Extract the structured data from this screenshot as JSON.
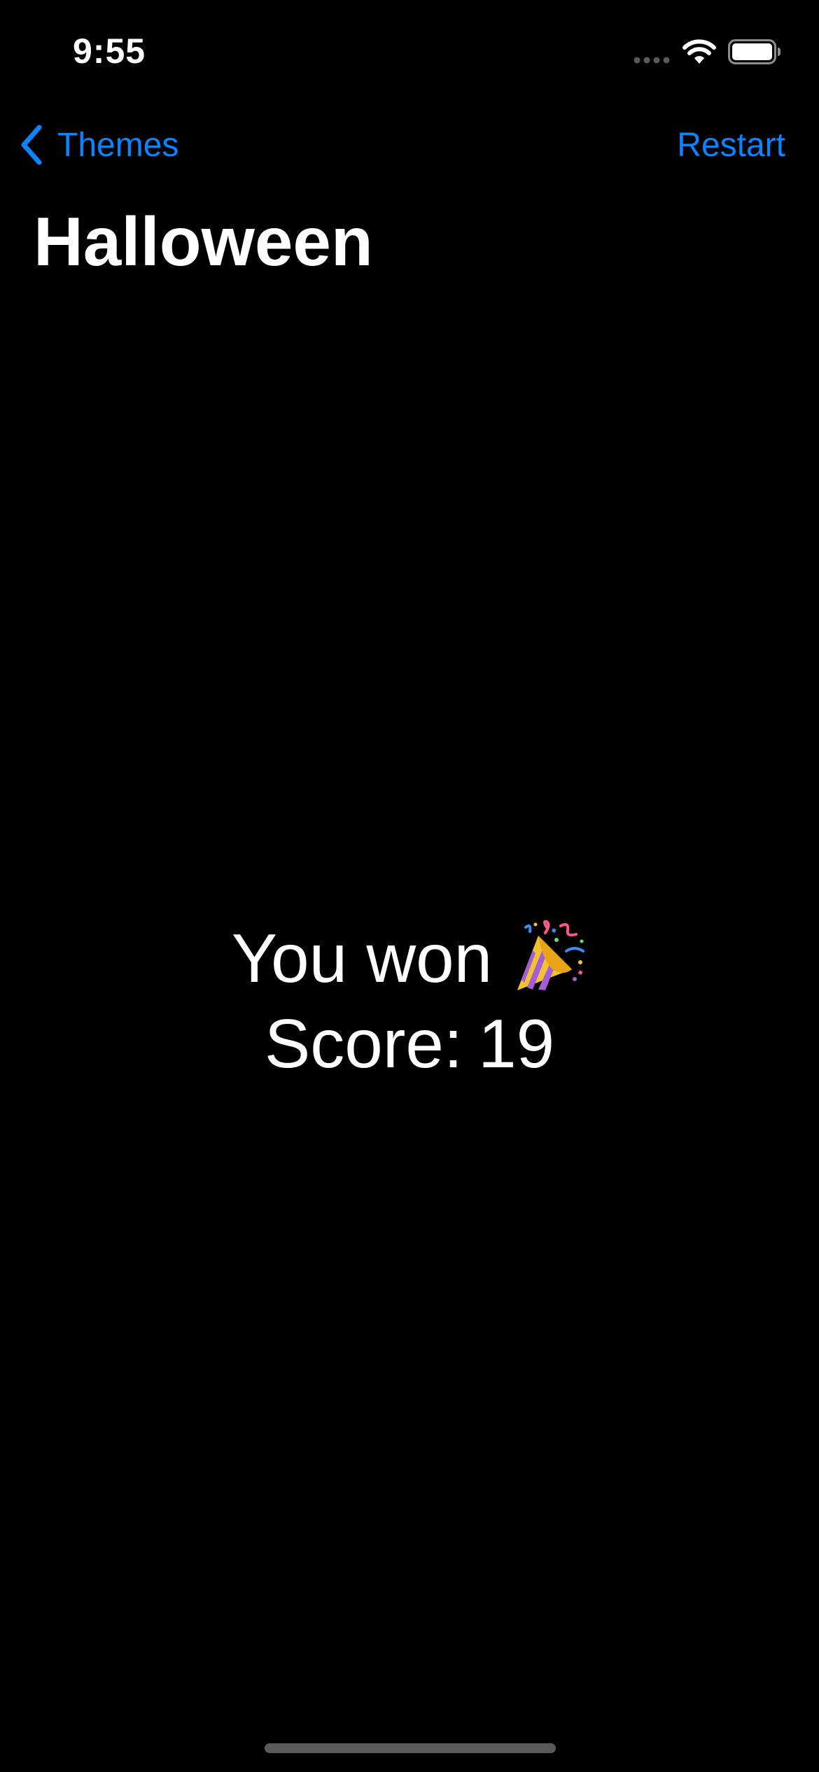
{
  "status_bar": {
    "time": "9:55",
    "signal_icon": "cellular-signal-dots",
    "wifi_icon": "wifi",
    "battery_icon": "battery-full"
  },
  "nav": {
    "back_label": "Themes",
    "back_icon": "chevron-left",
    "action_label": "Restart"
  },
  "title": "Halloween",
  "result": {
    "message": "You won",
    "emoji_icon": "party-popper",
    "score_label": "Score:",
    "score_value": "19"
  },
  "colors": {
    "background": "#000000",
    "accent": "#0a84ff",
    "text": "#ffffff"
  }
}
